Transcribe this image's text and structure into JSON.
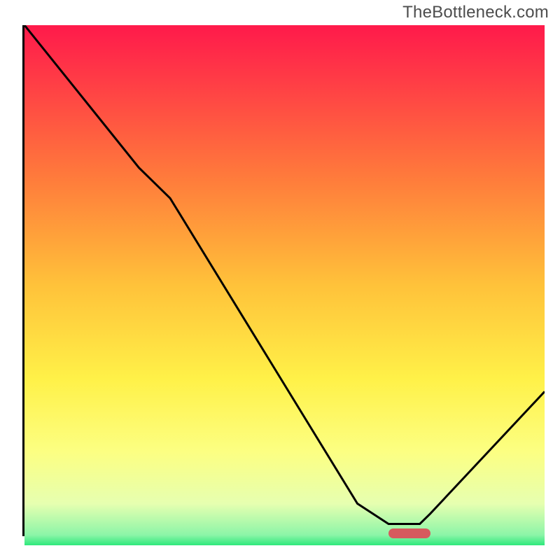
{
  "watermark": "TheBottleneck.com",
  "chart_data": {
    "type": "line",
    "title": "",
    "xlabel": "",
    "ylabel": "",
    "xlim": [
      0,
      100
    ],
    "ylim": [
      0,
      100
    ],
    "series": [
      {
        "name": "curve",
        "x": [
          0,
          22,
          28,
          64,
          70,
          76,
          78,
          100
        ],
        "values": [
          100,
          72,
          66,
          6,
          2,
          2,
          4,
          28
        ]
      }
    ],
    "marker": {
      "x_start": 70,
      "x_end": 78,
      "y": 0.5
    },
    "gradient_stops": [
      {
        "pct": 0,
        "color": "#ff1a4b"
      },
      {
        "pct": 10,
        "color": "#ff3a46"
      },
      {
        "pct": 30,
        "color": "#ff7d3b"
      },
      {
        "pct": 50,
        "color": "#ffc23a"
      },
      {
        "pct": 68,
        "color": "#fff148"
      },
      {
        "pct": 82,
        "color": "#fcff82"
      },
      {
        "pct": 92,
        "color": "#e6ffb0"
      },
      {
        "pct": 98,
        "color": "#8cf5a8"
      },
      {
        "pct": 100,
        "color": "#2ee87b"
      }
    ],
    "curve_color": "#000000",
    "marker_color": "#d65a5e",
    "axis_color": "#000000"
  }
}
